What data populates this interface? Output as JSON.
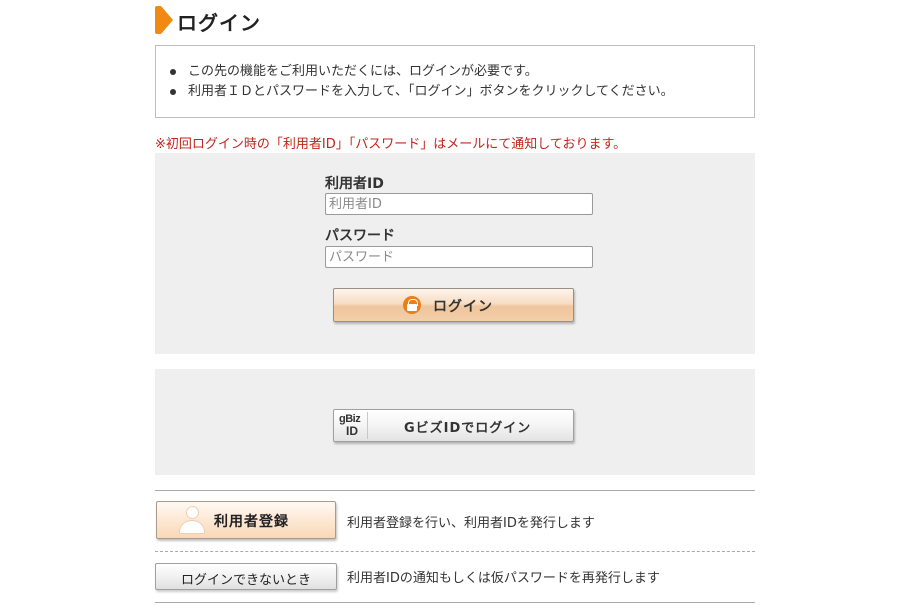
{
  "page": {
    "title": "ログイン"
  },
  "notice": {
    "items": [
      "この先の機能をご利用いただくには、ログインが必要です。",
      "利用者ＩＤとパスワードを入力して、「ログイン」ボタンをクリックしてください。"
    ]
  },
  "warning": "※初回ログイン時の「利用者ID」「パスワード」はメールにて通知しております。",
  "login_form": {
    "user_id_label": "利用者ID",
    "user_id_placeholder": "利用者ID",
    "user_id_value": "",
    "password_label": "パスワード",
    "password_placeholder": "パスワード",
    "password_value": "",
    "login_button_label": "ログイン"
  },
  "gbiz": {
    "logo_top": "gBiz",
    "logo_bottom": "ID",
    "button_label": "GビズIDでログイン"
  },
  "register": {
    "button_label": "利用者登録",
    "description": "利用者登録を行い、利用者IDを発行します"
  },
  "forgot": {
    "button_label": "ログインできないとき",
    "description": "利用者IDの通知もしくは仮パスワードを再発行します"
  },
  "colors": {
    "accent": "#f08a12",
    "warning": "#c0261d",
    "panel_bg": "#efefef"
  },
  "icons": {
    "title_marker": "title-marker-icon",
    "login": "lock-icon",
    "gbiz": "gbiz-logo-icon",
    "register": "user-icon"
  }
}
